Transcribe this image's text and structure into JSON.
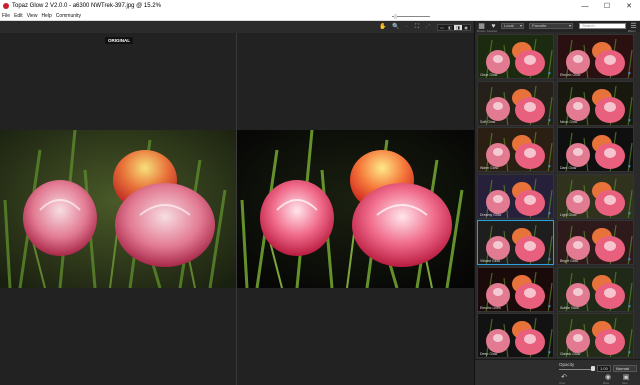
{
  "window": {
    "title": "Topaz Glow 2 V2.0.0 - a6300 NWTrek-397.jpg @ 15.2%",
    "minimize": "—",
    "maximize": "☐",
    "close": "✕"
  },
  "menu": [
    "File",
    "Edit",
    "View",
    "Help",
    "Community"
  ],
  "toolbar": {
    "hand_icon": "✋",
    "zoom_in_icon": "🔍",
    "zoom_out_icon": "−",
    "fit_icon": "⛶",
    "full_icon": "⤢",
    "view_modes": [
      "▭",
      "◧",
      "◨",
      "◼"
    ],
    "zoom_level_fraction": 0.05
  },
  "canvas": {
    "original_label": "ORIGINAL"
  },
  "right_panel": {
    "presets_label": "Presets",
    "favorites_label": "Favorites",
    "category_dropdown": "Local",
    "sort_dropdown": "Favorite",
    "search_placeholder": "Search",
    "settings_label": "Effects",
    "presets": [
      {
        "name": "Clear Glow",
        "selected": false
      },
      {
        "name": "Electric Glow",
        "selected": false
      },
      {
        "name": "Soft Glow",
        "selected": false
      },
      {
        "name": "Neon Glow",
        "selected": false
      },
      {
        "name": "Warm Glow",
        "selected": false
      },
      {
        "name": "Dark Glow",
        "selected": false
      },
      {
        "name": "Dreamy Glow",
        "selected": false
      },
      {
        "name": "Light Glow",
        "selected": false
      },
      {
        "name": "Vibrant Glow",
        "selected": true
      },
      {
        "name": "Bright Glow",
        "selected": false
      },
      {
        "name": "Electric Lines",
        "selected": false
      },
      {
        "name": "Subtle Glow",
        "selected": false
      },
      {
        "name": "Deep Glow",
        "selected": false
      },
      {
        "name": "Classic Glow",
        "selected": false
      }
    ],
    "opacity_label": "Opacity",
    "opacity_value": "1.00",
    "opacity_fraction": 1.0,
    "blend_mode": "Normal",
    "undo_label": "Undo",
    "mask_label": "Mask",
    "save_label": "Save"
  },
  "colors": {
    "accent": "#2e9fe0",
    "background": "#1e1e1e",
    "panel": "#2a2a2a"
  }
}
